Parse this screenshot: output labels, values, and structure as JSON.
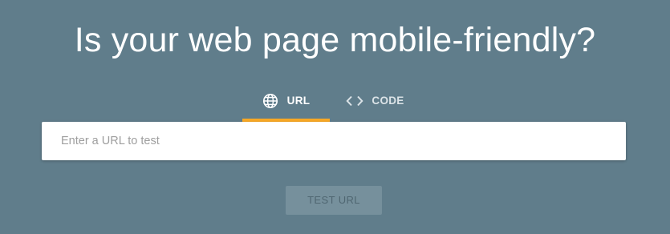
{
  "header": {
    "title": "Is your web page mobile-friendly?"
  },
  "tabs": [
    {
      "label": "URL",
      "icon": "globe-icon",
      "active": true
    },
    {
      "label": "CODE",
      "icon": "code-icon",
      "active": false
    }
  ],
  "url_input": {
    "placeholder": "Enter a URL to test",
    "value": ""
  },
  "actions": {
    "test_label": "TEST URL",
    "test_enabled": false
  },
  "colors": {
    "background": "#607d8b",
    "active_tab_indicator": "#f9a825",
    "disabled_button_bg": "#76909c"
  }
}
